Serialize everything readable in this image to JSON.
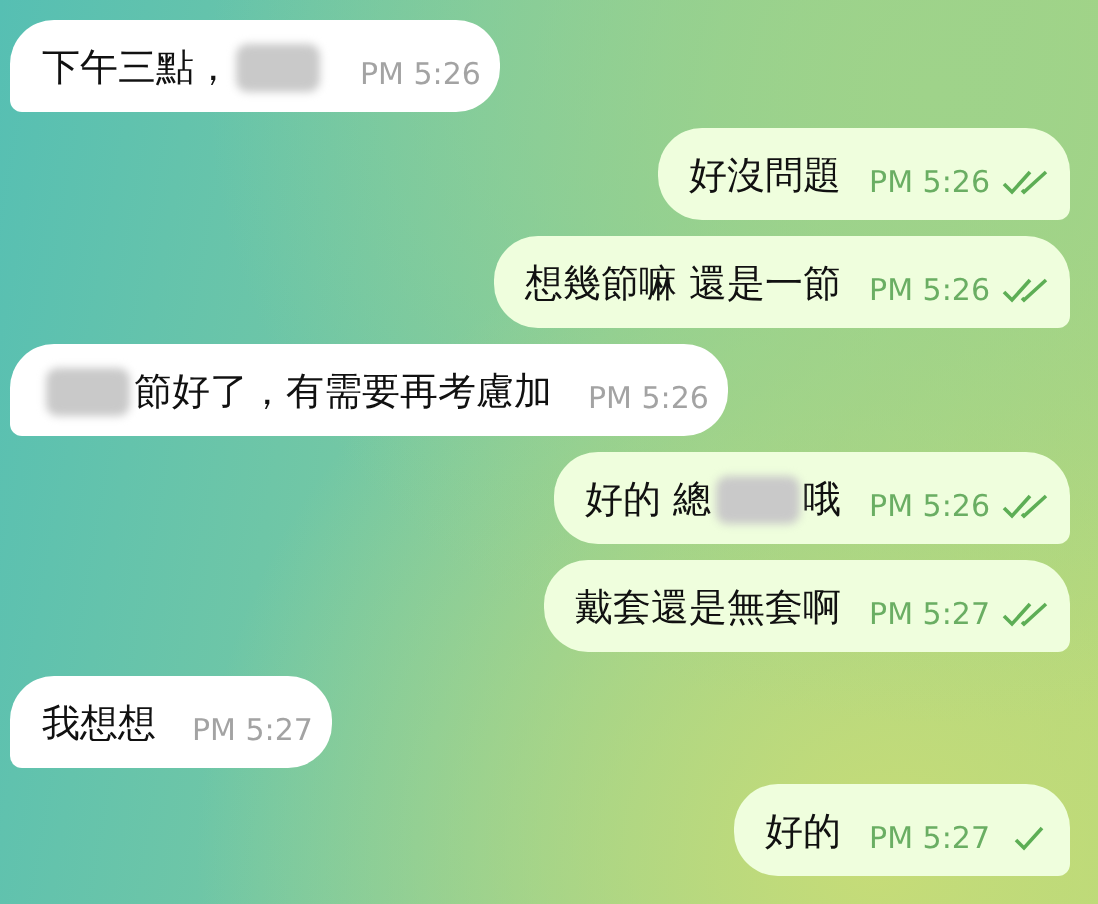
{
  "messages": [
    {
      "kind": "incoming",
      "parts": [
        {
          "kind": "text",
          "text": "下午三點，"
        },
        {
          "kind": "blur"
        }
      ],
      "time": "PM 5:26"
    },
    {
      "kind": "outgoing",
      "parts": [
        {
          "kind": "text",
          "text": "好沒問題"
        }
      ],
      "time": "PM 5:26",
      "read": true
    },
    {
      "kind": "outgoing",
      "parts": [
        {
          "kind": "text",
          "text": "想幾節嘛 還是一節"
        }
      ],
      "time": "PM 5:26",
      "read": true
    },
    {
      "kind": "incoming",
      "parts": [
        {
          "kind": "blur"
        },
        {
          "kind": "text",
          "text": "節好了，有需要再考慮加"
        }
      ],
      "time": "PM 5:26"
    },
    {
      "kind": "outgoing",
      "parts": [
        {
          "kind": "text",
          "text": "好的 總"
        },
        {
          "kind": "blur"
        },
        {
          "kind": "text",
          "text": "哦"
        }
      ],
      "time": "PM 5:26",
      "read": true
    },
    {
      "kind": "outgoing",
      "parts": [
        {
          "kind": "text",
          "text": "戴套還是無套啊"
        }
      ],
      "time": "PM 5:27",
      "read": true
    },
    {
      "kind": "incoming",
      "parts": [
        {
          "kind": "text",
          "text": "我想想"
        }
      ],
      "time": "PM 5:27"
    },
    {
      "kind": "outgoing",
      "parts": [
        {
          "kind": "text",
          "text": "好的"
        }
      ],
      "time": "PM 5:27",
      "read": false
    }
  ]
}
